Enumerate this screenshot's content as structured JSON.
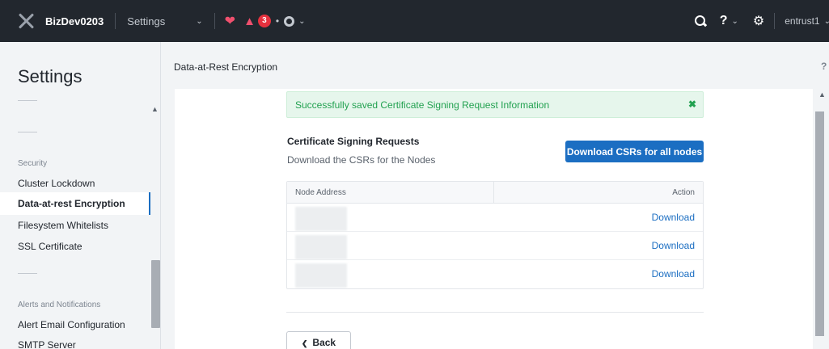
{
  "topbar": {
    "cluster_name": "BizDev0203",
    "section": "Settings",
    "alert_count": "3",
    "username": "entrust1"
  },
  "sidebar": {
    "title": "Settings",
    "sections": [
      {
        "label": "Security",
        "items": [
          "Cluster Lockdown",
          "Data-at-rest Encryption",
          "Filesystem Whitelists",
          "SSL Certificate"
        ]
      },
      {
        "label": "Alerts and Notifications",
        "items": [
          "Alert Email Configuration",
          "SMTP Server"
        ]
      }
    ],
    "active_item": "Data-at-rest Encryption"
  },
  "main": {
    "page_title": "Data-at-Rest Encryption",
    "help": "?",
    "success_message": "Successfully saved Certificate Signing Request Information",
    "csr_heading": "Certificate Signing Requests",
    "csr_subtitle": "Download the CSRs for the Nodes",
    "download_all_label": "Download CSRs for all nodes",
    "table": {
      "columns": [
        "Node Address",
        "Action"
      ],
      "rows": [
        {
          "action": "Download"
        },
        {
          "action": "Download"
        },
        {
          "action": "Download"
        }
      ]
    },
    "back_label": "Back"
  }
}
